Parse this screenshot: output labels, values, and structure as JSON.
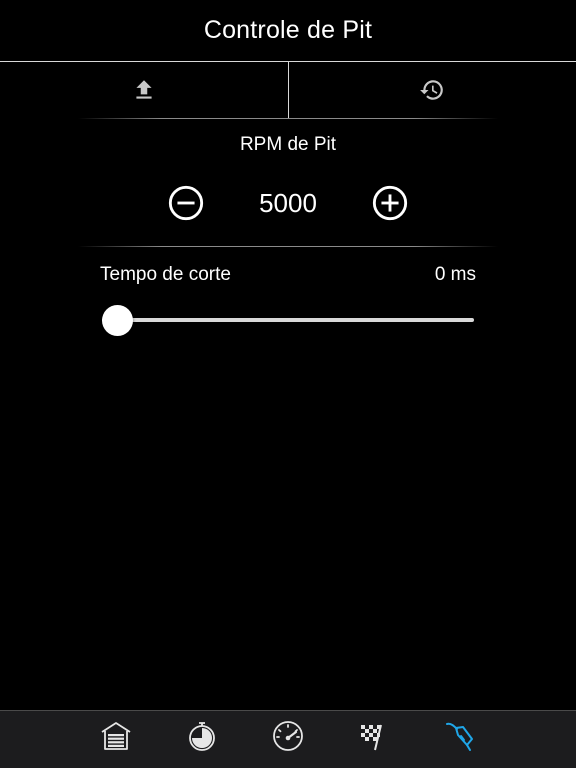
{
  "header": {
    "title": "Controle de Pit"
  },
  "toolbar": {
    "items": [
      {
        "icon": "upload-icon",
        "color": "#c8c8c8"
      },
      {
        "icon": "history-icon",
        "color": "#c8c8c8"
      }
    ]
  },
  "rpm": {
    "label": "RPM de Pit",
    "value": "5000",
    "decrement_icon": "minus-circle-icon",
    "increment_icon": "plus-circle-icon"
  },
  "cut_time": {
    "label": "Tempo de corte",
    "value_text": "0 ms",
    "slider_fraction": 0
  },
  "tabs": {
    "active_index": 4,
    "active_color": "#1fa6e8",
    "inactive_color": "#e6e6e6",
    "items": [
      {
        "icon": "garage-icon"
      },
      {
        "icon": "stopwatch-icon"
      },
      {
        "icon": "speedometer-icon"
      },
      {
        "icon": "checkered-flag-icon"
      },
      {
        "icon": "fuel-nozzle-icon"
      }
    ]
  }
}
